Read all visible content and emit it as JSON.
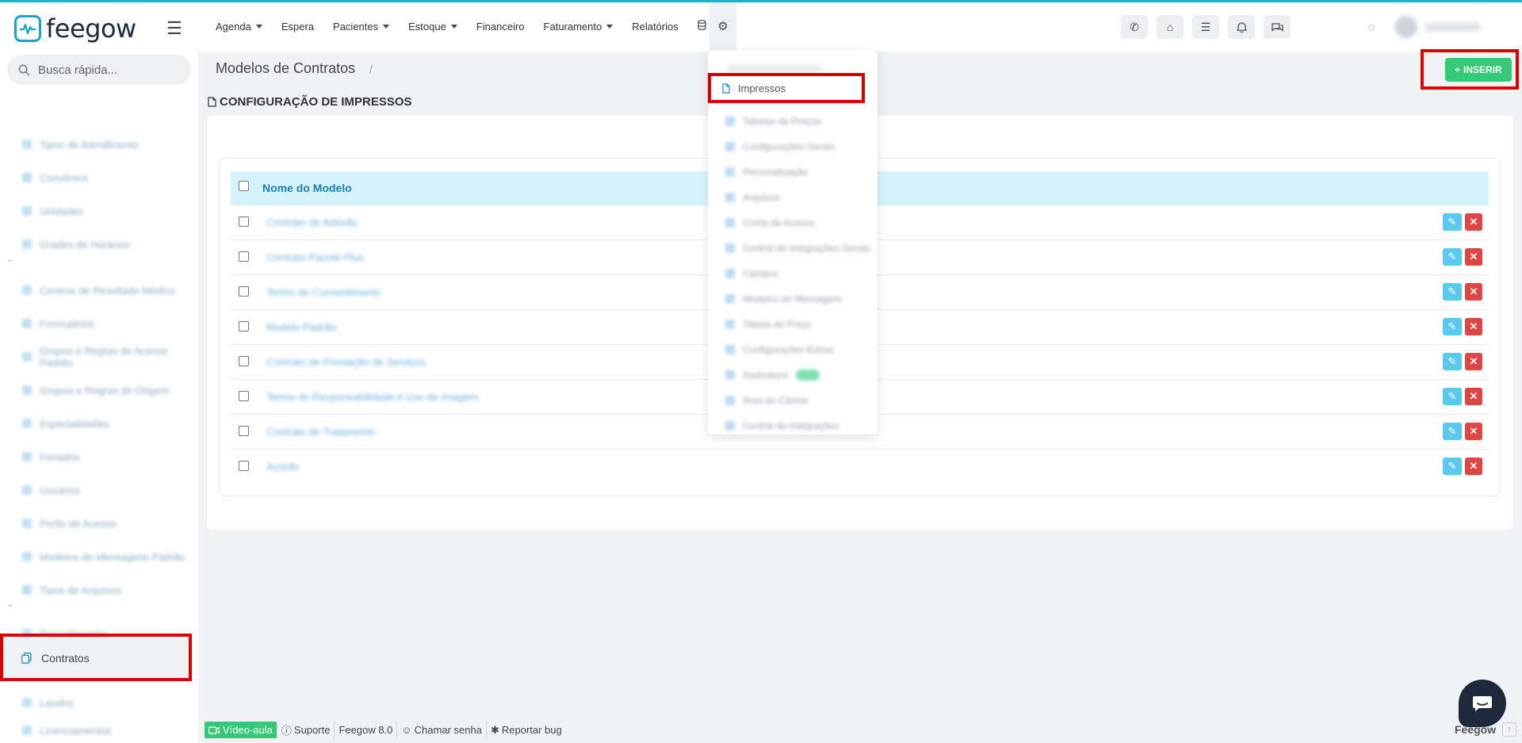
{
  "brand": {
    "name": "feegow"
  },
  "search": {
    "placeholder": "Busca rápida..."
  },
  "nav": {
    "items": [
      {
        "label": "Agenda",
        "dropdown": true
      },
      {
        "label": "Espera",
        "dropdown": false
      },
      {
        "label": "Pacientes",
        "dropdown": true
      },
      {
        "label": "Estoque",
        "dropdown": true
      },
      {
        "label": "Financeiro",
        "dropdown": false
      },
      {
        "label": "Faturamento",
        "dropdown": true
      },
      {
        "label": "Relatórios",
        "dropdown": false
      }
    ],
    "icons": [
      "database-icon",
      "gear-icon"
    ],
    "actions": [
      "phone-icon",
      "inbox-icon",
      "tasks-icon",
      "bell-icon",
      "chat-icon"
    ]
  },
  "sidebar": {
    "active_item": {
      "label": "Contratos",
      "icon": "copy-icon"
    }
  },
  "page": {
    "title": "Modelos de Contratos",
    "breadcrumb_sep": "/",
    "insert_label": "INSERIR",
    "section_title": "CONFIGURAÇÃO DE IMPRESSOS"
  },
  "table": {
    "column_header": "Nome do Modelo",
    "rows": [
      {
        "name": "Contrato de Adesão"
      },
      {
        "name": "Contrato Pacote Plus"
      },
      {
        "name": "Termo de Consentimento"
      },
      {
        "name": "Modelo Padrão"
      },
      {
        "name": "Contrato de Prestação de Serviços"
      },
      {
        "name": "Termo de Responsabilidade e Uso de Imagem"
      },
      {
        "name": "Contrato de Tratamento"
      },
      {
        "name": "Acordo"
      }
    ]
  },
  "dropdown": {
    "main_item": {
      "label": "Impressos",
      "icon": "file-icon"
    },
    "blurred_item_count": 13
  },
  "footer": {
    "video_label": "Vídeo-aula",
    "support_label": "Suporte",
    "version_label": "Feegow 8.0",
    "call_label": "Chamar senha",
    "bug_label": "Reportar bug",
    "brand": "Feegow"
  },
  "colors": {
    "accent": "#1bb5c9",
    "insert_green": "#34c877",
    "delete_red": "#e04444",
    "edit_blue": "#5bc8ee",
    "highlight_red": "#dd0000"
  }
}
